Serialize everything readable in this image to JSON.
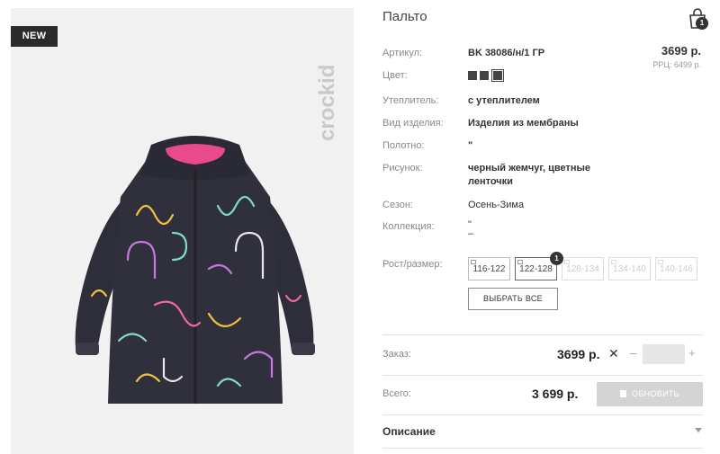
{
  "badge": "NEW",
  "brand": "crockid",
  "product": {
    "title": "Пальто",
    "price": "3699 р.",
    "rrp": "РРЦ: 6499 р."
  },
  "cart": {
    "count": "1"
  },
  "details": {
    "article_label": "Артикул:",
    "article_value": "BK 38086/н/1 ГР",
    "color_label": "Цвет:",
    "insulation_label": "Утеплитель:",
    "insulation_value": "с утеплителем",
    "type_label": "Вид изделия:",
    "type_value": "Изделия из мембраны",
    "fabric_label": "Полотно:",
    "fabric_value": "\"",
    "pattern_label": "Рисунок:",
    "pattern_line1": "черный жемчуг, цветные",
    "pattern_line2": "ленточки",
    "season_label": "Сезон:",
    "season_value": "Осень-Зима",
    "collection_label": "Коллекция:",
    "collection_line1": "\"",
    "collection_line2": "–",
    "size_label": "Рост/размер:"
  },
  "colors": [
    "#444444",
    "#444444",
    "#444444"
  ],
  "sizes": [
    {
      "label": "116-122",
      "state": "available"
    },
    {
      "label": "122-128",
      "state": "selected"
    },
    {
      "label": "128-134",
      "state": "unavailable"
    },
    {
      "label": "134-140",
      "state": "unavailable"
    },
    {
      "label": "140-146",
      "state": "unavailable"
    }
  ],
  "size_selected_count": "1",
  "select_all_label": "ВЫБРАТЬ ВСЕ",
  "order": {
    "label": "Заказ:",
    "price": "3699 р.",
    "times": "✕",
    "minus": "–",
    "plus": "+",
    "quantity": ""
  },
  "total": {
    "label": "Всего:",
    "value": "3 699 р.",
    "update_label": "ОБНОВИТЬ"
  },
  "description_label": "Описание"
}
